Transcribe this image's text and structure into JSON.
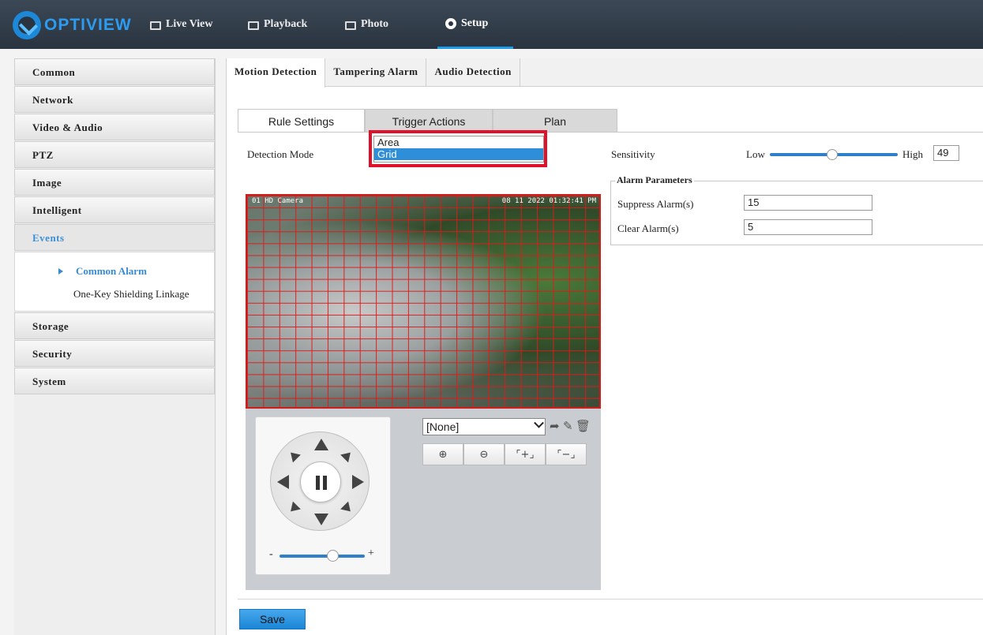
{
  "brand": {
    "name": "OPTIVIEW"
  },
  "topnav": [
    {
      "label": "Live View",
      "icon": "monitor-icon"
    },
    {
      "label": "Playback",
      "icon": "film-icon"
    },
    {
      "label": "Photo",
      "icon": "photo-icon"
    },
    {
      "label": "Setup",
      "icon": "gear-icon",
      "active": true
    }
  ],
  "sidebar": {
    "items": [
      "Common",
      "Network",
      "Video & Audio",
      "PTZ",
      "Image",
      "Intelligent",
      "Events",
      "Storage",
      "Security",
      "System"
    ],
    "active": "Events",
    "subitems": [
      "Common Alarm",
      "One-Key Shielding Linkage"
    ],
    "active_sub": "Common Alarm"
  },
  "tabs": [
    "Motion Detection",
    "Tampering Alarm",
    "Audio Detection"
  ],
  "subtabs": [
    "Rule Settings",
    "Trigger Actions",
    "Plan"
  ],
  "detection": {
    "label": "Detection Mode",
    "options": [
      "Area",
      "Grid"
    ],
    "selected": "Grid"
  },
  "sensitivity": {
    "label": "Sensitivity",
    "low": "Low",
    "high": "High",
    "value": "49",
    "fraction": 0.49
  },
  "alarm_params": {
    "title": "Alarm Parameters",
    "suppress_label": "Suppress Alarm(s)",
    "suppress_value": "15",
    "clear_label": "Clear Alarm(s)",
    "clear_value": "5"
  },
  "video": {
    "osd_left": "01  HD Camera",
    "osd_right": "08 11 2022 01:32:41 PM"
  },
  "ptz": {
    "preset": "[None]",
    "zoom_minus": "-",
    "zoom_plus": "+"
  },
  "buttons": {
    "save": "Save"
  },
  "colors": {
    "accent": "#1e9be8",
    "highlight": "#e0112b",
    "grid": "#e11919"
  }
}
